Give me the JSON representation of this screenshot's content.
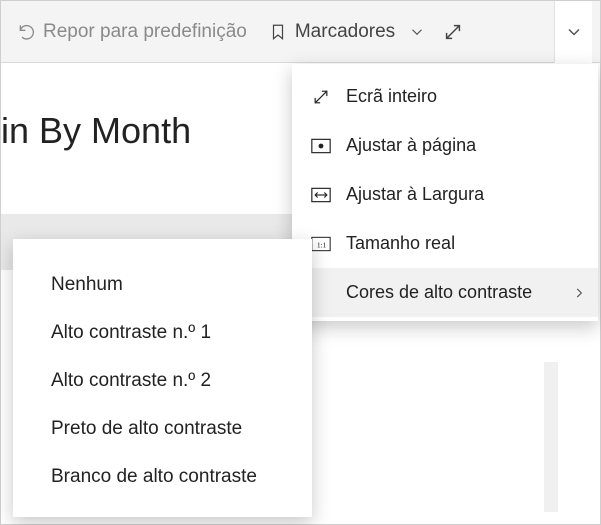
{
  "toolbar": {
    "reset_label": "Repor para predefinição",
    "bookmarks_label": "Marcadores"
  },
  "page": {
    "title_fragment": "in By Month"
  },
  "view_menu": {
    "items": [
      {
        "label": "Ecrã inteiro"
      },
      {
        "label": "Ajustar à página"
      },
      {
        "label": "Ajustar à Largura"
      },
      {
        "label": "Tamanho real"
      },
      {
        "label": "Cores de alto contraste"
      }
    ]
  },
  "contrast_submenu": {
    "items": [
      {
        "label": "Nenhum"
      },
      {
        "label": "Alto contraste n.º 1"
      },
      {
        "label": "Alto contraste n.º 2"
      },
      {
        "label": "Preto de alto contraste"
      },
      {
        "label": "Branco de alto contraste"
      }
    ]
  }
}
